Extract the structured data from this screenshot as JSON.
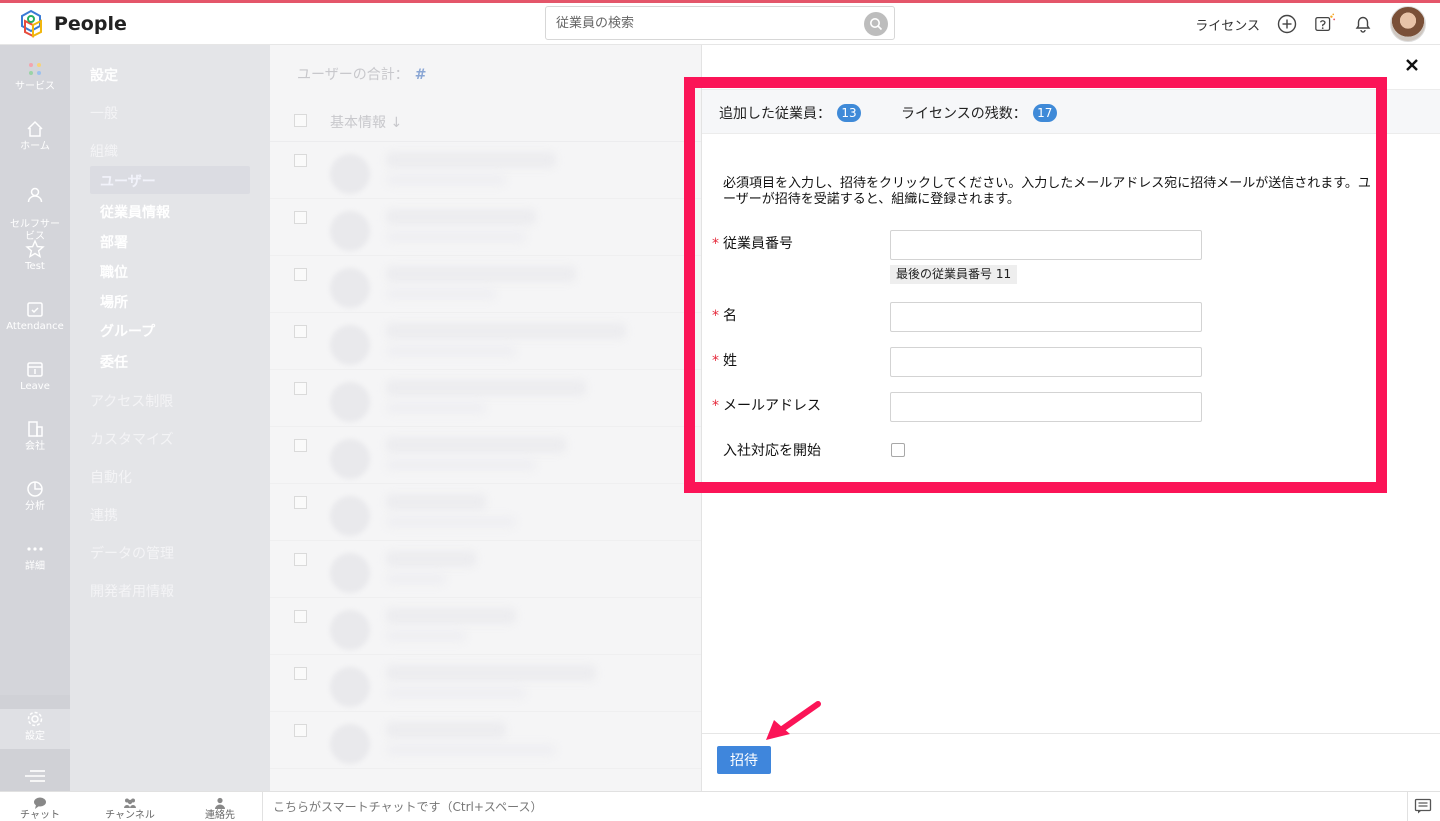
{
  "app": {
    "name": "People"
  },
  "header": {
    "search_placeholder": "従業員の検索",
    "license_label": "ライセンス"
  },
  "rail": {
    "items": [
      {
        "label": "サービス",
        "icon": "apps-icon"
      },
      {
        "label": "ホーム",
        "icon": "home-icon"
      },
      {
        "label": "セルフサー\nビス",
        "icon": "user-icon"
      },
      {
        "label": "Test",
        "icon": "star-icon"
      },
      {
        "label": "Attendance",
        "icon": "calendar-check-icon"
      },
      {
        "label": "Leave",
        "icon": "calendar-icon"
      },
      {
        "label": "会社",
        "icon": "building-icon"
      },
      {
        "label": "分析",
        "icon": "pie-chart-icon"
      },
      {
        "label": "詳細",
        "icon": "more-icon"
      }
    ],
    "settings_label": "設定"
  },
  "settings_nav": {
    "title": "設定",
    "general": "一般",
    "organization": "組織",
    "users": "ユーザー",
    "sub": [
      "従業員情報",
      "部署",
      "職位",
      "場所",
      "グループ",
      "委任"
    ],
    "access": "アクセス制限",
    "customize": "カスタマイズ",
    "automation": "自動化",
    "integration": "連携",
    "data_mgmt": "データの管理",
    "developer": "開発者用情報"
  },
  "user_list": {
    "total_label": "ユーザーの合計：",
    "total_value": "#",
    "column": "基本情報 ↓"
  },
  "invite_panel": {
    "added_label": "追加した従業員：",
    "added_count": "13",
    "remaining_label": "ライセンスの残数：",
    "remaining_count": "17",
    "intro": "必須項目を入力し、招待をクリックしてください。入力したメールアドレス宛に招待メールが送信されます。ユーザーが招待を受諾すると、組織に登録されます。",
    "fields": {
      "employee_id": "従業員番号",
      "first_name": "名",
      "last_name": "姓",
      "email": "メールアドレス",
      "onboarding": "入社対応を開始"
    },
    "required_mark": "*",
    "last_employee_hint": "最後の従業員番号 11",
    "invite_button": "招待",
    "close": "✕"
  },
  "bottom_bar": {
    "chat": "チャット",
    "channels": "チャンネル",
    "contacts": "連絡先",
    "smartchat_placeholder": "こちらがスマートチャットです（Ctrl+スペース）"
  },
  "colors": {
    "accent": "#3f86dc",
    "highlight": "#fb1457",
    "required": "#e5283a"
  }
}
